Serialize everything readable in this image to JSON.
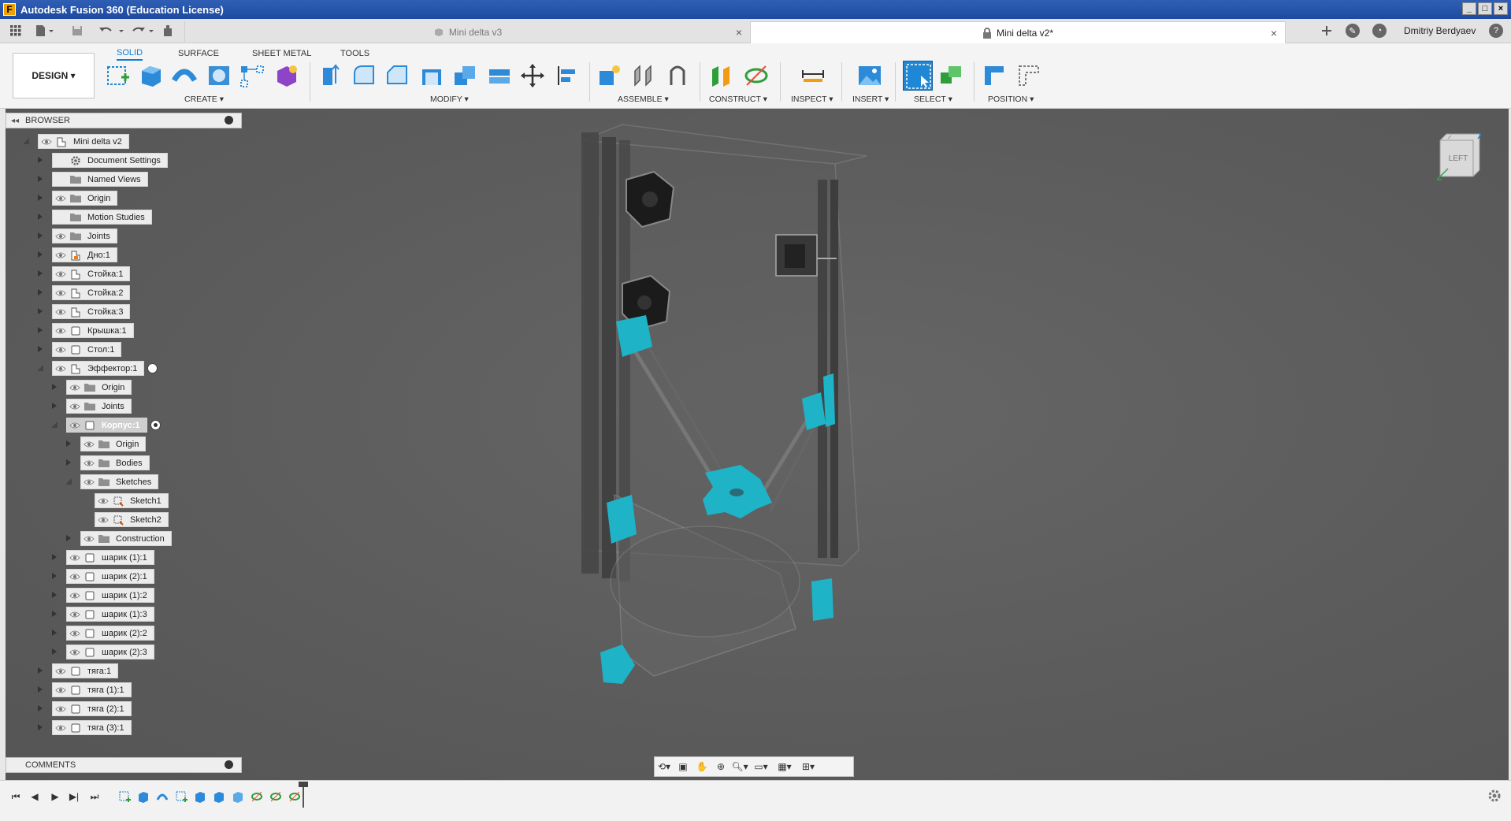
{
  "window": {
    "title": "Autodesk Fusion 360 (Education License)",
    "logo_letter": "F",
    "controls": [
      "_",
      "□",
      "×"
    ]
  },
  "tabs": {
    "inactive": {
      "label": "Mini delta v3"
    },
    "active": {
      "label": "Mini delta v2*"
    },
    "close_glyph": "×",
    "user_name": "Dmitriy Berdyaev"
  },
  "toolbar": {
    "workspace_button": "DESIGN ▾",
    "workspace_tabs": [
      "SOLID",
      "SURFACE",
      "SHEET METAL",
      "TOOLS"
    ],
    "groups": [
      {
        "label": "CREATE ▾"
      },
      {
        "label": "MODIFY ▾"
      },
      {
        "label": "ASSEMBLE ▾"
      },
      {
        "label": "CONSTRUCT ▾"
      },
      {
        "label": "INSPECT ▾"
      },
      {
        "label": "INSERT ▾"
      },
      {
        "label": "SELECT ▾"
      },
      {
        "label": "POSITION ▾"
      }
    ]
  },
  "browser": {
    "title": "BROWSER",
    "nodes": [
      {
        "label": "Mini delta v2",
        "type": "component",
        "depth": 0,
        "expanded": true,
        "eye": true
      },
      {
        "label": "Document Settings",
        "type": "settings",
        "depth": 1,
        "expanded": false,
        "eye": false
      },
      {
        "label": "Named Views",
        "type": "folder",
        "depth": 1,
        "expanded": false,
        "eye": false
      },
      {
        "label": "Origin",
        "type": "folder",
        "depth": 1,
        "expanded": false,
        "eye": true
      },
      {
        "label": "Motion Studies",
        "type": "folder",
        "depth": 1,
        "expanded": false,
        "eye": false
      },
      {
        "label": "Joints",
        "type": "folder",
        "depth": 1,
        "expanded": false,
        "eye": true
      },
      {
        "label": "Дно:1",
        "type": "component-ref",
        "depth": 1,
        "expanded": false,
        "eye": true
      },
      {
        "label": "Стойка:1",
        "type": "component",
        "depth": 1,
        "expanded": false,
        "eye": true
      },
      {
        "label": "Стойка:2",
        "type": "component",
        "depth": 1,
        "expanded": false,
        "eye": true
      },
      {
        "label": "Стойка:3",
        "type": "component",
        "depth": 1,
        "expanded": false,
        "eye": true
      },
      {
        "label": "Крышка:1",
        "type": "body",
        "depth": 1,
        "expanded": false,
        "eye": true
      },
      {
        "label": "Стол:1",
        "type": "body",
        "depth": 1,
        "expanded": false,
        "eye": true
      },
      {
        "label": "Эффектор:1",
        "type": "component",
        "depth": 1,
        "expanded": true,
        "eye": true,
        "radio": true
      },
      {
        "label": "Origin",
        "type": "folder",
        "depth": 2,
        "expanded": false,
        "eye": true
      },
      {
        "label": "Joints",
        "type": "folder",
        "depth": 2,
        "expanded": false,
        "eye": true
      },
      {
        "label": "Корпус:1",
        "type": "body",
        "depth": 2,
        "expanded": true,
        "eye": true,
        "active": true,
        "radio": true
      },
      {
        "label": "Origin",
        "type": "folder",
        "depth": 3,
        "expanded": false,
        "eye": true
      },
      {
        "label": "Bodies",
        "type": "folder",
        "depth": 3,
        "expanded": false,
        "eye": true
      },
      {
        "label": "Sketches",
        "type": "folder",
        "depth": 3,
        "expanded": true,
        "eye": true
      },
      {
        "label": "Sketch1",
        "type": "sketch",
        "depth": 4,
        "leaf": true,
        "eye": true
      },
      {
        "label": "Sketch2",
        "type": "sketch",
        "depth": 4,
        "leaf": true,
        "eye": true
      },
      {
        "label": "Construction",
        "type": "folder",
        "depth": 3,
        "expanded": false,
        "eye": true
      },
      {
        "label": "шарик (1):1",
        "type": "body",
        "depth": 2,
        "expanded": false,
        "eye": true
      },
      {
        "label": "шарик (2):1",
        "type": "body",
        "depth": 2,
        "expanded": false,
        "eye": true
      },
      {
        "label": "шарик (1):2",
        "type": "body",
        "depth": 2,
        "expanded": false,
        "eye": true
      },
      {
        "label": "шарик (1):3",
        "type": "body",
        "depth": 2,
        "expanded": false,
        "eye": true
      },
      {
        "label": "шарик (2):2",
        "type": "body",
        "depth": 2,
        "expanded": false,
        "eye": true
      },
      {
        "label": "шарик (2):3",
        "type": "body",
        "depth": 2,
        "expanded": false,
        "eye": true
      },
      {
        "label": "тяга:1",
        "type": "body",
        "depth": 1,
        "expanded": false,
        "eye": true
      },
      {
        "label": "тяга (1):1",
        "type": "body",
        "depth": 1,
        "expanded": false,
        "eye": true
      },
      {
        "label": "тяга (2):1",
        "type": "body",
        "depth": 1,
        "expanded": false,
        "eye": true
      },
      {
        "label": "тяга (3):1",
        "type": "body",
        "depth": 1,
        "expanded": false,
        "eye": true
      }
    ]
  },
  "comments": {
    "title": "COMMENTS"
  },
  "viewcube": {
    "face_label": "LEFT"
  },
  "colors": {
    "accent": "#0a7fd4",
    "titlebar": "#1d4aa0",
    "highlight_part": "#1fb3c8"
  }
}
